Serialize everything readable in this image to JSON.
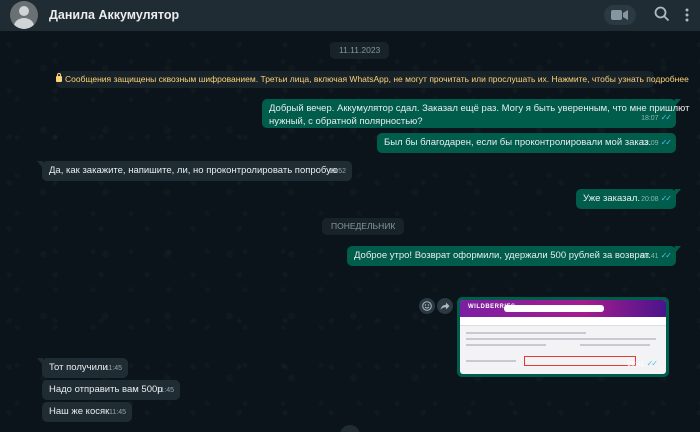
{
  "header": {
    "contact_name": "Данила Аккумулятор"
  },
  "chat": {
    "date_1": "11.11.2023",
    "encryption_notice": "Сообщения защищены сквозным шифрованием. Третьи лица, включая WhatsApp, не могут прочитать или прослушать их. Нажмите, чтобы узнать подробнее",
    "date_2": "ПОНЕДЕЛЬНИК",
    "messages": [
      {
        "direction": "out",
        "line1": "Добрый вечер. Аккумулятор сдал. Заказал ещё раз. Могу я быть уверенным, что мне пришлют",
        "line2": "нужный, с обратной полярностью?",
        "time": "18:07"
      },
      {
        "direction": "out",
        "text": "Был бы благодарен, если бы проконтролировали мой заказ.",
        "time": "18:09"
      },
      {
        "direction": "in",
        "text": "Да, как закажите, напишите, ли, но проконтролировать попробую",
        "time": "19:52"
      },
      {
        "direction": "out",
        "text": "Уже заказал.",
        "time": "20:08"
      },
      {
        "direction": "out",
        "text": "Доброе утро! Возврат оформили, удержали 500 рублей за возврат.",
        "time": "08:41"
      },
      {
        "direction": "out",
        "type": "image",
        "image_logo": "WILDBERRIES",
        "time": "08:41"
      },
      {
        "direction": "in",
        "text": "Тот получили",
        "time": "11:45"
      },
      {
        "direction": "in",
        "text": "Надо отправить вам 500р",
        "time": "11:45"
      },
      {
        "direction": "in",
        "text": "Наш же косяк",
        "time": "11:45"
      }
    ]
  },
  "icons": [
    "video-call-icon",
    "search-icon",
    "menu-icon",
    "lock-icon",
    "emoji-icon",
    "forward-icon",
    "double-check-icon"
  ],
  "colors": {
    "background": "#0b141a",
    "header": "#202c33",
    "outgoing_bubble": "#005c4b",
    "incoming_bubble": "#202c33",
    "read_ticks": "#53bdeb",
    "encryption_text": "#ffd279"
  }
}
